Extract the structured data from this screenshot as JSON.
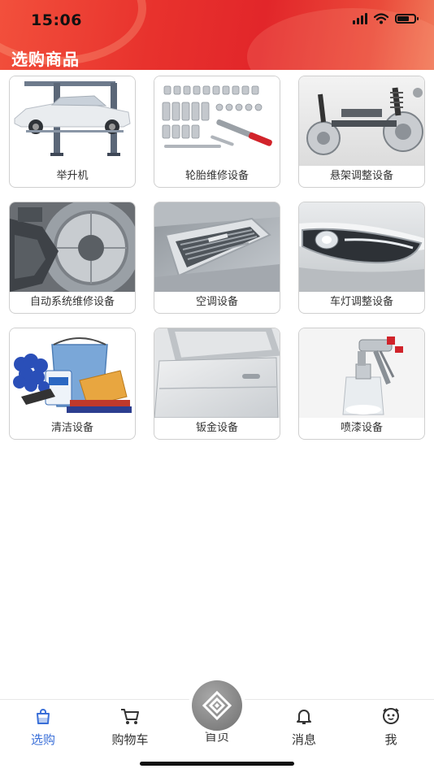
{
  "status_bar": {
    "time": "15:06"
  },
  "header": {
    "title": "选购商品"
  },
  "categories": [
    {
      "label": "举升机",
      "icon": "car-lift-image"
    },
    {
      "label": "轮胎维修设备",
      "icon": "socket-wrench-set-image"
    },
    {
      "label": "悬架调整设备",
      "icon": "suspension-image"
    },
    {
      "label": "自动系统维修设备",
      "icon": "brake-disc-image"
    },
    {
      "label": "空调设备",
      "icon": "air-vent-image"
    },
    {
      "label": "车灯调整设备",
      "icon": "headlight-image"
    },
    {
      "label": "清洁设备",
      "icon": "cleaning-supplies-image"
    },
    {
      "label": "钣金设备",
      "icon": "car-door-image"
    },
    {
      "label": "喷漆设备",
      "icon": "spray-gun-image"
    }
  ],
  "tabbar": {
    "items": [
      {
        "label": "选购",
        "icon": "shopping-bag-icon",
        "active": true
      },
      {
        "label": "购物车",
        "icon": "cart-icon",
        "active": false
      },
      {
        "label": "首页",
        "icon": "home-logo-icon",
        "active": false
      },
      {
        "label": "消息",
        "icon": "bell-icon",
        "active": false
      },
      {
        "label": "我",
        "icon": "smiley-icon",
        "active": false
      }
    ]
  },
  "colors": {
    "header_red": "#e2262a",
    "active_blue": "#3a6fd8"
  }
}
